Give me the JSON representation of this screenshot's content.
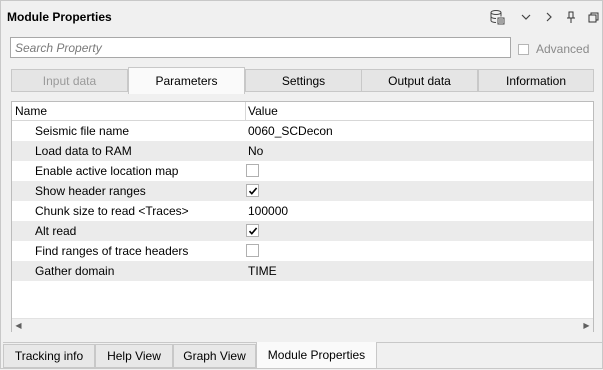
{
  "window": {
    "title": "Module Properties"
  },
  "toolbar_icons": [
    "database-icon",
    "chevron-down-icon",
    "chevron-right-icon",
    "pin-icon",
    "restore-icon"
  ],
  "search": {
    "placeholder": "Search Property",
    "value": ""
  },
  "advanced": {
    "label": "Advanced",
    "checked": false
  },
  "tabs": [
    {
      "label": "Input data",
      "state": "disabled"
    },
    {
      "label": "Parameters",
      "state": "active"
    },
    {
      "label": "Settings",
      "state": "normal"
    },
    {
      "label": "Output data",
      "state": "normal"
    },
    {
      "label": "Information",
      "state": "normal"
    }
  ],
  "table": {
    "headers": {
      "name": "Name",
      "value": "Value"
    },
    "rows": [
      {
        "name": "Seismic file name",
        "value": "0060_SCDecon"
      },
      {
        "name": "Load data to RAM",
        "value": "No"
      },
      {
        "name": "Enable active location map",
        "checked": false
      },
      {
        "name": "Show header ranges",
        "checked": true
      },
      {
        "name": "Chunk size to read <Traces>",
        "value": "100000"
      },
      {
        "name": "Alt read",
        "checked": true
      },
      {
        "name": "Find ranges of trace headers",
        "checked": false
      },
      {
        "name": "Gather domain",
        "value": "TIME"
      }
    ]
  },
  "bottom_tabs": [
    {
      "label": "Tracking info",
      "active": false
    },
    {
      "label": "Help View",
      "active": false
    },
    {
      "label": "Graph View",
      "active": false
    },
    {
      "label": "Module Properties",
      "active": true
    }
  ]
}
